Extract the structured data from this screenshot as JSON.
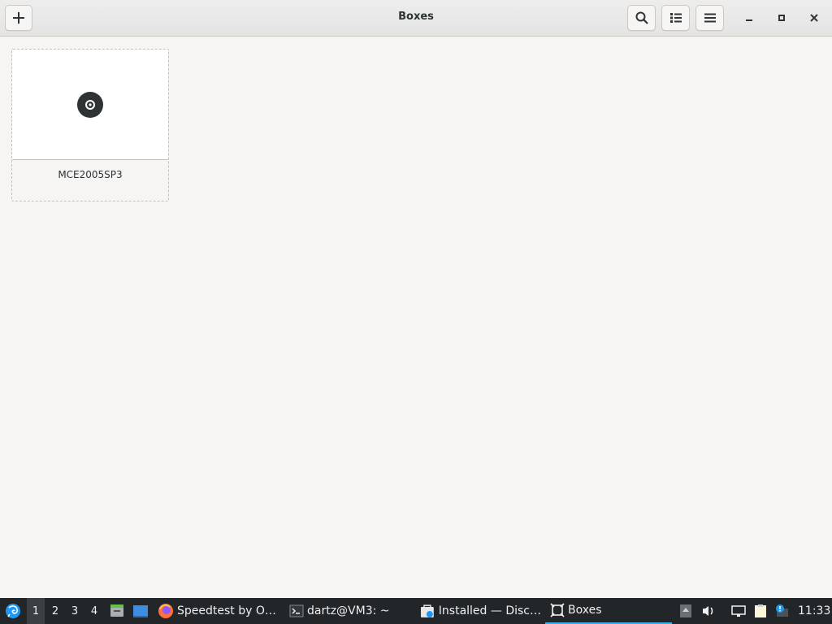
{
  "window": {
    "title": "Boxes"
  },
  "headerbar": {
    "new_button_icon": "plus-icon",
    "search_button_icon": "search-icon",
    "view_toggle_icon": "list-view-icon",
    "menu_button_icon": "hamburger-menu-icon",
    "minimize_icon": "minimize-icon",
    "maximize_icon": "maximize-icon",
    "close_icon": "close-icon"
  },
  "machines": [
    {
      "name": "MCE2005SP3",
      "icon": "disc-icon"
    }
  ],
  "taskbar": {
    "launcher_icon": "app-launcher-icon",
    "desktops": [
      "1",
      "2",
      "3",
      "4"
    ],
    "active_desktop": "1",
    "quick_launch": [
      "file-manager-icon",
      "show-desktop-icon"
    ],
    "tasks": [
      {
        "label": "Speedtest by O…",
        "icon": "firefox-icon"
      },
      {
        "label": "dartz@VM3: ~",
        "icon": "terminal-icon"
      },
      {
        "label": "Installed — Disc…",
        "icon": "discover-icon"
      },
      {
        "label": "Boxes",
        "icon": "boxes-icon"
      }
    ],
    "tray": [
      "storage-icon",
      "volume-icon",
      "network-icon",
      "clipboard-icon",
      "updates-icon"
    ],
    "clock": "11:33"
  },
  "colors": {
    "accent": "#3daee9",
    "taskbar_bg": "#232629",
    "window_bg": "#f6f5f4"
  }
}
